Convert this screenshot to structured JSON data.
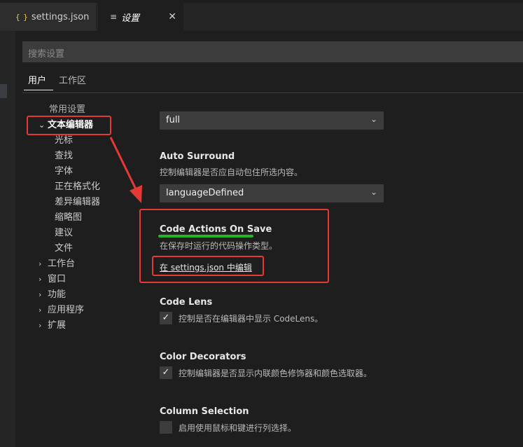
{
  "tabs": [
    {
      "label": "settings.json",
      "icon": "{ }"
    },
    {
      "label": "设置",
      "icon": "≡",
      "close": "✕"
    }
  ],
  "search": {
    "placeholder": "搜索设置"
  },
  "scope_tabs": {
    "user": "用户",
    "workspace": "工作区"
  },
  "toc": {
    "common": "常用设置",
    "text_editor": "文本编辑器",
    "children": [
      "光标",
      "查找",
      "字体",
      "正在格式化",
      "差异编辑器",
      "缩略图",
      "建议",
      "文件"
    ],
    "groups": [
      "工作台",
      "窗口",
      "功能",
      "应用程序",
      "扩展"
    ]
  },
  "settings": {
    "top_dropdown_value": "full",
    "auto_surround": {
      "title": "Auto Surround",
      "desc": "控制编辑器是否应自动包住所选内容。",
      "value": "languageDefined"
    },
    "code_actions": {
      "title": "Code Actions On Save",
      "desc": "在保存时运行的代码操作类型。",
      "link": "在 settings.json 中编辑"
    },
    "code_lens": {
      "title": "Code Lens",
      "desc": "控制是否在编辑器中显示 CodeLens。",
      "checked": true
    },
    "color_decorators": {
      "title": "Color Decorators",
      "desc": "控制编辑器是否显示内联颜色修饰器和颜色选取器。",
      "checked": true
    },
    "column_selection": {
      "title": "Column Selection",
      "desc": "启用使用鼠标和键进行列选择。",
      "checked": false
    }
  },
  "glyphs": {
    "check": "✓",
    "caret": "⌄",
    "chevron_right": "›",
    "chevron_down": "⌄"
  },
  "colors": {
    "annotation_red": "#e53935",
    "annotation_green": "#23b323",
    "json_icon": "#e8c94f"
  }
}
